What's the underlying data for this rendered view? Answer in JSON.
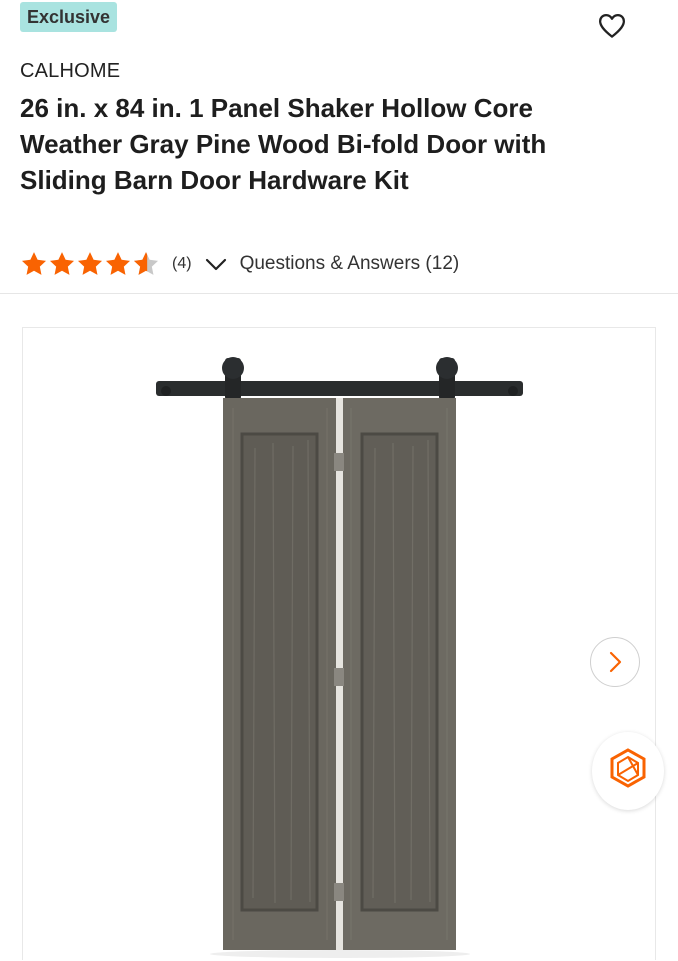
{
  "badge": "Exclusive",
  "brand": "CALHOME",
  "title": "26 in. x 84 in. 1 Panel Shaker Hollow Core Weather Gray Pine Wood Bi-fold Door with Sliding Barn Door Hardware Kit",
  "rating": {
    "value": 4.5,
    "count_label": "(4)"
  },
  "qa_label": "Questions & Answers (12)",
  "icons": {
    "favorite": "heart-outline-icon",
    "expand": "chevron-down-icon",
    "next": "chevron-right-icon",
    "ar": "hexagon-ar-icon"
  },
  "colors": {
    "badge_bg": "#a9e3e0",
    "star": "#f96302",
    "text": "#1e1e1e"
  }
}
